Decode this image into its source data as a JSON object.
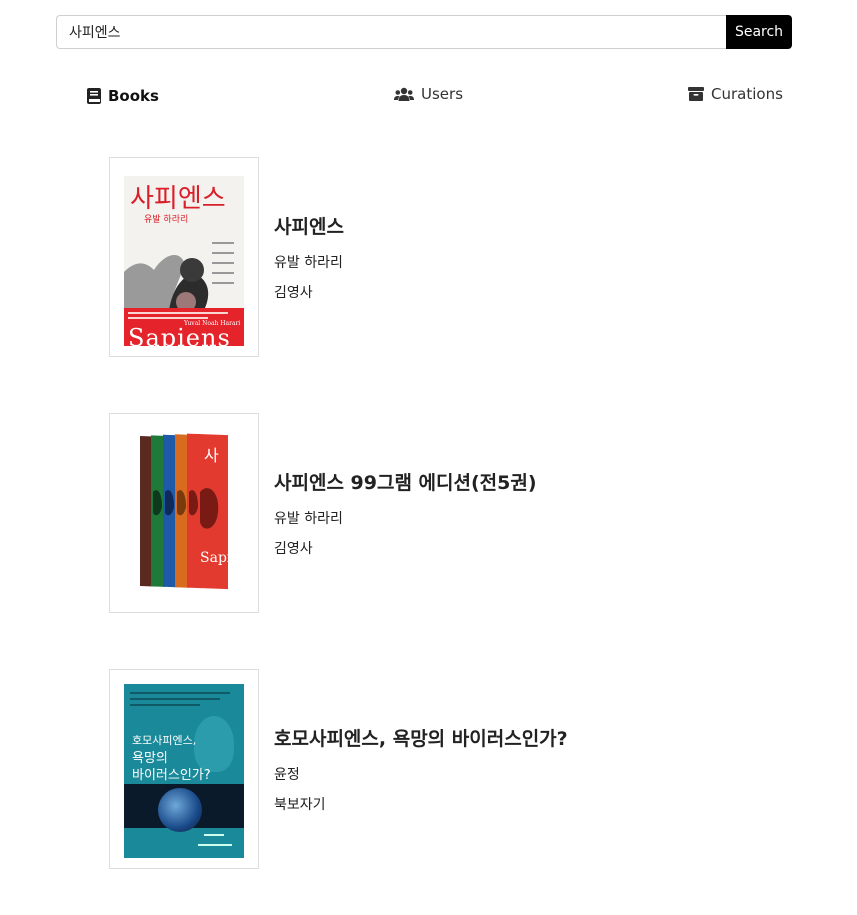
{
  "search": {
    "value": "사피엔스",
    "button_label": "Search"
  },
  "tabs": [
    {
      "label": "Books",
      "icon": "book-icon",
      "active": true
    },
    {
      "label": "Users",
      "icon": "users-icon",
      "active": false
    },
    {
      "label": "Curations",
      "icon": "archive-icon",
      "active": false
    }
  ],
  "books": [
    {
      "title": "사피엔스",
      "author": "유발 하라리",
      "publisher": "김영사",
      "cover": {
        "title_text": "사피엔스",
        "author_text": "유발 하라리",
        "spine_text": "Sapiens",
        "byline": "Yuval Noah Harari",
        "accent_color": "#d9202a"
      }
    },
    {
      "title": "사피엔스 99그램 에디션(전5권)",
      "author": "유발 하라리",
      "publisher": "김영사",
      "cover": {
        "spine_text": "Sapiens",
        "volume_label": "사",
        "colors": [
          "#5a2a20",
          "#1f7a3a",
          "#1e5aa8",
          "#d96b1e",
          "#e23a2e"
        ]
      }
    },
    {
      "title": "호모사피엔스, 욕망의 바이러스인가?",
      "author": "윤정",
      "publisher": "북보자기",
      "cover": {
        "title_line1": "호모사피엔스,",
        "title_line2": "욕망의",
        "title_line3": "바이러스인가?",
        "accent_color": "#1a8a9a"
      }
    }
  ]
}
